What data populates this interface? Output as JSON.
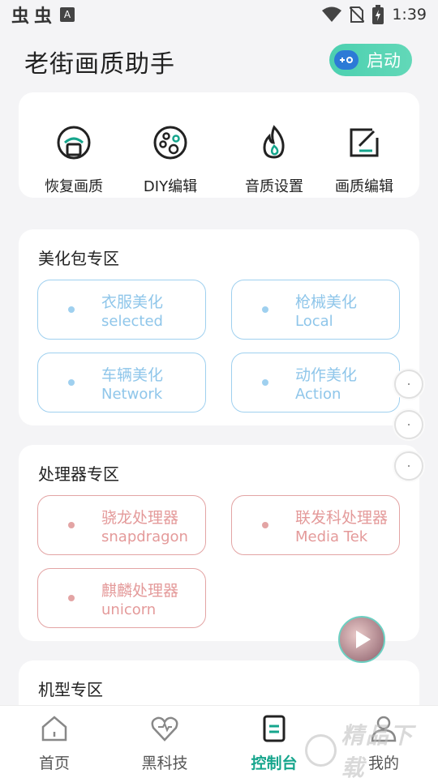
{
  "status_bar": {
    "left_glyphs": [
      "虫",
      "虫"
    ],
    "notification_badge": "A",
    "time": "1:39"
  },
  "header": {
    "title": "老街画质助手",
    "launch_button": "启动"
  },
  "tools": [
    {
      "label": "恢复画质",
      "icon": "restore-icon"
    },
    {
      "label": "DIY编辑",
      "icon": "palette-icon"
    },
    {
      "label": "音质设置",
      "icon": "flame-icon"
    },
    {
      "label": "画质编辑",
      "icon": "edit-icon"
    }
  ],
  "beautify_section": {
    "title": "美化包专区",
    "items": [
      {
        "name": "衣服美化",
        "sub": "selected"
      },
      {
        "name": "枪械美化",
        "sub": "Local"
      },
      {
        "name": "车辆美化",
        "sub": "Network"
      },
      {
        "name": "动作美化",
        "sub": "Action"
      }
    ]
  },
  "processor_section": {
    "title": "处理器专区",
    "items": [
      {
        "name": "骁龙处理器",
        "sub": "snapdragon"
      },
      {
        "name": "联发科处理器",
        "sub": "Media Tek"
      },
      {
        "name": "麒麟处理器",
        "sub": "unicorn"
      }
    ]
  },
  "model_section": {
    "title": "机型专区"
  },
  "bottom_nav": {
    "items": [
      {
        "label": "首页",
        "icon": "home-icon"
      },
      {
        "label": "黑科技",
        "icon": "heart-icon"
      },
      {
        "label": "控制台",
        "icon": "console-icon",
        "active": true
      },
      {
        "label": "我的",
        "icon": "user-icon"
      }
    ]
  },
  "watermark": {
    "text": "精品下载"
  },
  "colors": {
    "accent": "#15a58c",
    "launch_green": "#4cd0b0",
    "blue_outline": "#9fd0ef",
    "red_outline": "#e3a4a4",
    "background": "#f4f4f6"
  }
}
